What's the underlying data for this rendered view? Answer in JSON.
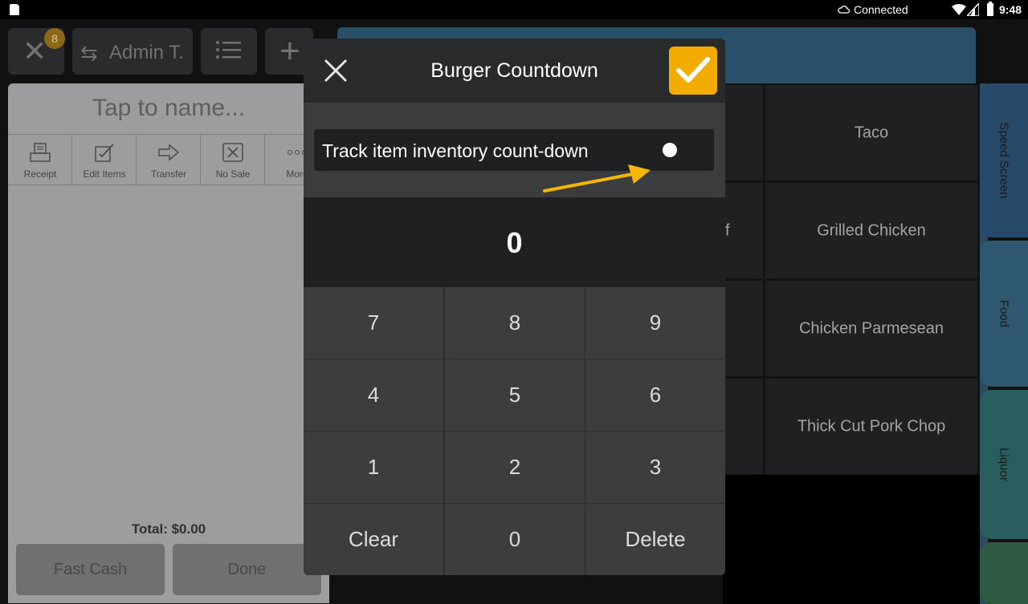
{
  "status_bar": {
    "connection": "Connected",
    "time": "9:48"
  },
  "toolbar": {
    "order_count_badge": "8",
    "admin_label": "Admin T."
  },
  "ticket": {
    "name_placeholder": "Tap to name...",
    "tools": [
      {
        "label": "Receipt",
        "icon": "receipt-icon"
      },
      {
        "label": "Edit Items",
        "icon": "edit-items-icon"
      },
      {
        "label": "Transfer",
        "icon": "transfer-arrow-icon"
      },
      {
        "label": "No Sale",
        "icon": "no-sale-icon"
      },
      {
        "label": "More",
        "icon": "more-dots-icon"
      }
    ],
    "total": "Total: $0.00",
    "fast_cash_label": "Fast Cash",
    "done_label": "Done"
  },
  "menu_grid": {
    "left_partial": [
      "",
      "f",
      "",
      ""
    ],
    "items": [
      "Taco",
      "Grilled Chicken",
      "Chicken Parmesean",
      "Thick Cut Pork Chop"
    ]
  },
  "side_tabs": [
    "Speed Screen",
    "Food",
    "Liquor",
    ""
  ],
  "modal": {
    "title": "Burger Countdown",
    "track_label": "Track item inventory count-down",
    "track_enabled": false,
    "value": "0",
    "keys": [
      "7",
      "8",
      "9",
      "4",
      "5",
      "6",
      "1",
      "2",
      "3",
      "Clear",
      "0",
      "Delete"
    ]
  },
  "colors": {
    "confirm_button": "#f2ac00",
    "annotation_arrow": "#f5b700",
    "badge": "#8a6a18"
  }
}
